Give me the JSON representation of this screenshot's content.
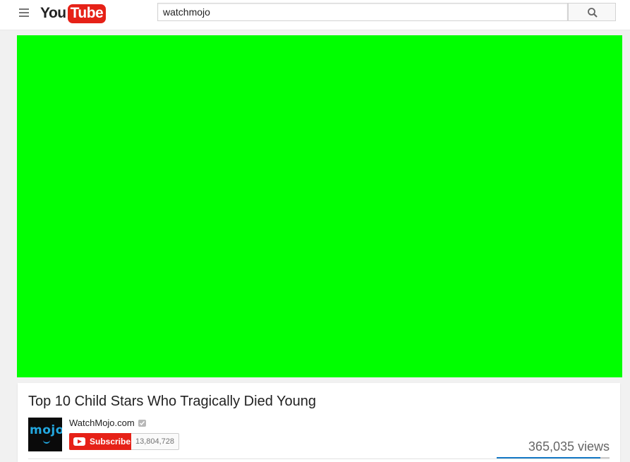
{
  "header": {
    "logo_you": "You",
    "logo_tube": "Tube",
    "search_value": "watchmojo",
    "menu_icon": "hamburger-menu-icon",
    "search_icon": "search-icon"
  },
  "player": {
    "background_color": "#00ff00"
  },
  "video": {
    "title": "Top 10 Child Stars Who Tragically Died Young",
    "channel_name": "WatchMojo.com",
    "avatar_text": "mojo",
    "subscribe_label": "Subscribe",
    "subscriber_count": "13,804,728",
    "view_count": "365,035 views",
    "like_ratio": 0.92
  },
  "colors": {
    "brand_red": "#e62117",
    "like_blue": "#167ac6"
  }
}
